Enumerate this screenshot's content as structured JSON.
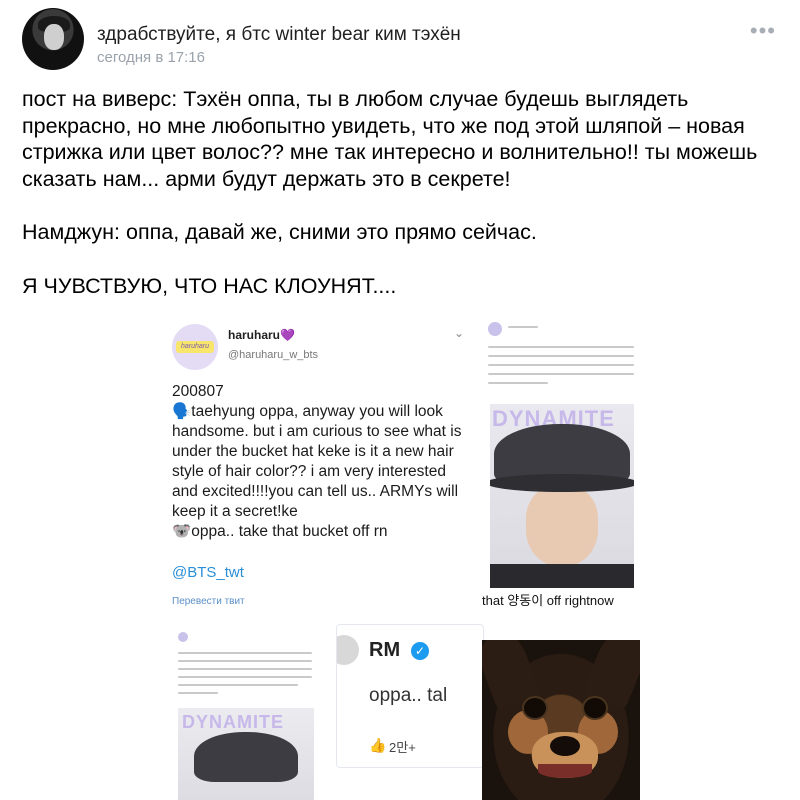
{
  "post": {
    "author": "здрабствуйте, я бтс winter bear ким тэхён",
    "time": "сегодня в 17:16",
    "more_icon": "more-dots-icon",
    "paragraphs": [
      "пост на виверс: Тэхён оппа, ты в любом случае будешь выглядеть прекрасно, но мне любопытно увидеть, что же под этой шляпой – новая стрижка или цвет волос?? мне так интересно и волнительно!! ты можешь сказать нам... арми будут держать это в секрете!",
      "Намджун: оппа, давай же, сними это прямо сейчас.",
      "Я ЧУВСТВУЮ, ЧТО НАС КЛОУНЯТ...."
    ]
  },
  "image": {
    "tweet": {
      "avatar_text": "haruharu",
      "name": "haruharu",
      "heart": "💜",
      "handle": "@haruharu_w_bts",
      "chevron": "⌄",
      "body": "200807\n🗣️taehyung oppa, anyway you will look handsome. but i am curious to see what is under the bucket hat keke is it a new hair style of hair color?? i am very interested and excited!!!!you can tell us.. ARMYs will keep it a secret!ke\n🐨oppa.. take that bucket off rn",
      "link": "@BTS_twt",
      "translate": "Перевести твит"
    },
    "right_top": {
      "dynamite": "DYNAMITE",
      "caption": "that 양동이 off rightnow"
    },
    "bottom_left": {
      "dynamite": "DYNAMITE"
    },
    "rm_card": {
      "name": "RM",
      "verified_icon": "verified-check-icon",
      "text": "oppa.. tal",
      "like_icon": "thumbs-up-icon",
      "likes": "2만+"
    }
  },
  "colors": {
    "link": "#2a8fd6",
    "time": "#9aa2ab",
    "verified": "#1d9bf0"
  }
}
